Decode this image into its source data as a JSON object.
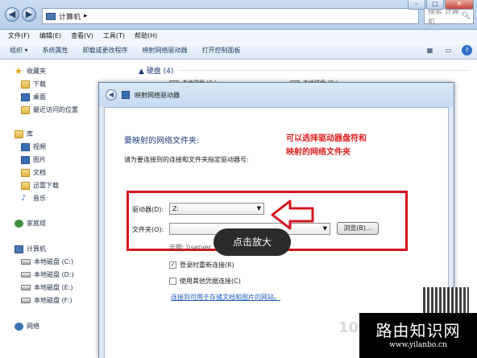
{
  "explorer": {
    "address_path": [
      "计算机",
      "▸"
    ],
    "search_placeholder": "搜索 计算机",
    "menu": [
      "文件(F)",
      "编辑(E)",
      "查看(V)",
      "工具(T)",
      "帮助(H)"
    ],
    "toolbar": [
      "组织 ▾",
      "系统属性",
      "卸载或更改程序",
      "映射网络驱动器",
      "打开控制面板"
    ],
    "sidebar": {
      "favorites": "收藏夹",
      "fav_items": [
        "下载",
        "桌面",
        "最近访问的位置"
      ],
      "library": "库",
      "lib_items": [
        "视频",
        "图片",
        "文档",
        "迅雷下载",
        "音乐"
      ],
      "homegroup": "家庭组",
      "computer": "计算机",
      "drives": [
        "本地磁盘 (C:)",
        "本地磁盘 (D:)",
        "本地磁盘 (E:)",
        "本地磁盘 (F:)"
      ],
      "network": "网络"
    },
    "main": {
      "section_title": "▲ 硬盘 (4)",
      "tiles": [
        "本地磁盘 (C:)",
        "本地磁盘 (D:)"
      ]
    }
  },
  "dialog": {
    "title": "映射网络驱动器",
    "heading": "要映射的网络文件夹:",
    "description": "请为要连接到的连接和文件夹指定驱动器号:",
    "annotation_line1": "可以选择驱动器盘符和",
    "annotation_line2": "映射的网络文件夹",
    "drive_label": "驱动器(D):",
    "drive_value": "Z:",
    "folder_label": "文件夹(O):",
    "folder_value": "",
    "browse_button": "浏览(B)...",
    "example": "示例: \\\\server",
    "tooltip": "点击放大",
    "reconnect_label": "登录时重新连接(R)",
    "reconnect_checked": true,
    "other_cred_label": "使用其他凭据连接(C)",
    "other_cred_checked": false,
    "link_text": "连接到可用于存储文档和图片的网站。"
  },
  "watermark": {
    "faded_text": "10",
    "brand_name": "路由知识网",
    "brand_url": "www.yilanbo.cn"
  },
  "colors": {
    "annotation_red": "#e0201f",
    "link_blue": "#1a5cc6"
  }
}
